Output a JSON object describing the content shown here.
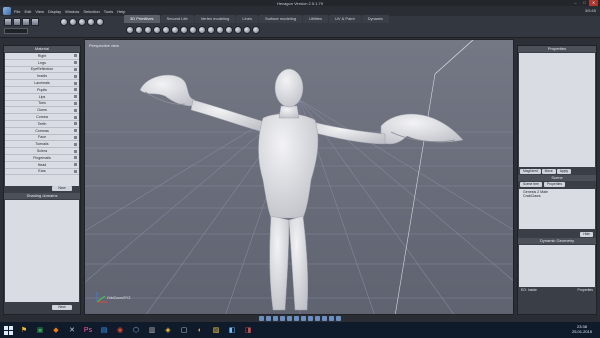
{
  "window": {
    "title": "Hexagon Version 2.5.1.79"
  },
  "menu": [
    "File",
    "Edit",
    "View",
    "Display",
    "Window",
    "Selection",
    "Tools",
    "Help"
  ],
  "menu_right": [
    "3/5.65"
  ],
  "tabs": [
    "3D Primitives",
    "Second Life",
    "Vertex modeling",
    "Lines",
    "Surface modeling",
    "Utilities",
    "UV & Paint",
    "Dynamic"
  ],
  "viewport": {
    "label": "Perspective view",
    "corner_label": "Orb/Zoom/XYZ"
  },
  "left_panel": {
    "title": "Material",
    "items": [
      "Right",
      "Legs",
      "EyeReflection",
      "Irradis",
      "Lacrimals",
      "Pupils",
      "Lips",
      "Toes",
      "Gums",
      "Cornea",
      "Teeth",
      "Corneas",
      "Face",
      "Toenails",
      "Sclera",
      "Fingernails",
      "Head",
      "Ears"
    ],
    "new_button": "New",
    "lower_title": "Shading domains",
    "lower_new_button": "New"
  },
  "right_panel": {
    "title": "Properties",
    "buttons": [
      "Mag/Ident",
      "Move",
      "Apply"
    ],
    "scene_title": "Scene",
    "scene_tabs": [
      "Scene tree",
      "Properties"
    ],
    "scene_items": [
      "Genesis 2 Male",
      "CrabClaws"
    ],
    "lower_button": "Hide",
    "lower_title": "Dynamic Geometry",
    "status_left": "EO: Inside",
    "status_right": "Properties"
  },
  "taskbar": {
    "time": "23:38",
    "date": "25.01.2015"
  },
  "colors": {
    "viewport": "#6b6f7b",
    "grid": "#7c808c",
    "figure": "#e6e7ea",
    "panel": "#3a3e46"
  }
}
